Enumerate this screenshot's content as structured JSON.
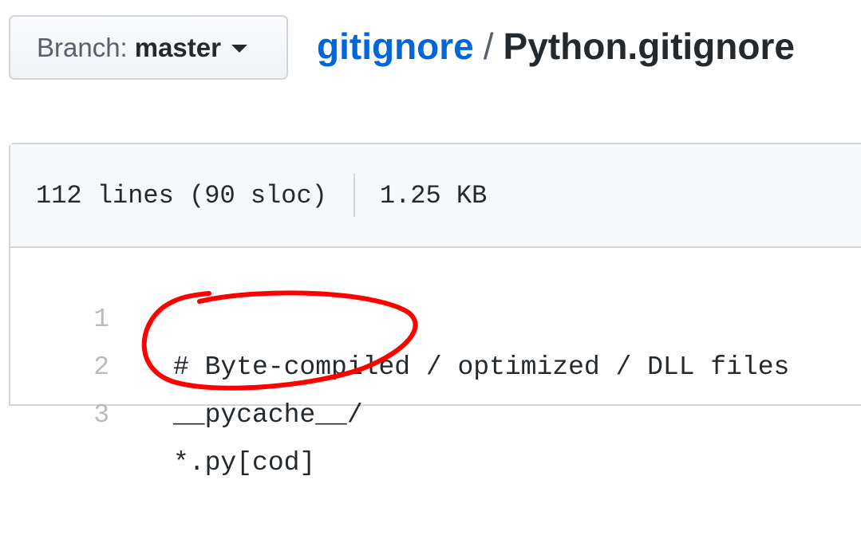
{
  "branch": {
    "prefix": "Branch:",
    "name": "master"
  },
  "breadcrumb": {
    "repo": "gitignore",
    "separator": "/",
    "file": "Python.gitignore"
  },
  "file_info": {
    "lines": "112 lines (90 sloc)",
    "size": "1.25 KB"
  },
  "code": [
    {
      "num": "1",
      "text": "# Byte-compiled / optimized / DLL files"
    },
    {
      "num": "2",
      "text": "__pycache__/"
    },
    {
      "num": "3",
      "text": "*.py[cod]"
    }
  ],
  "colors": {
    "link": "#0366d6",
    "annotation": "#ff0000"
  }
}
